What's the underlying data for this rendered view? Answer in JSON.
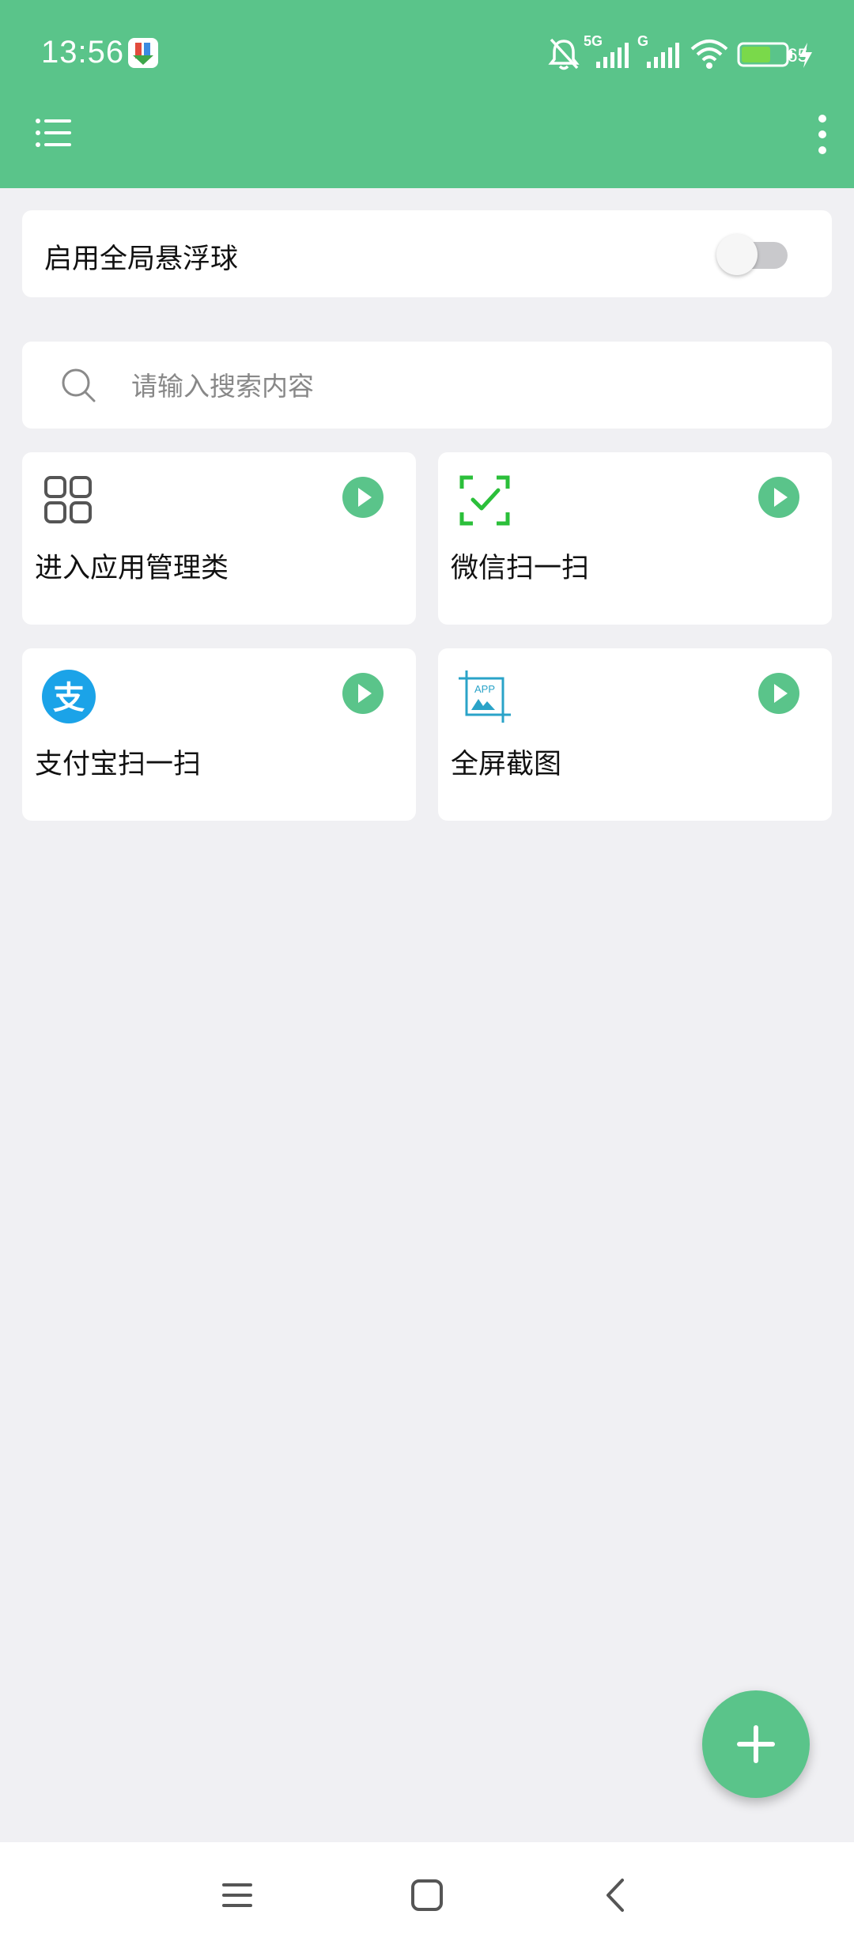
{
  "status_bar": {
    "time": "13:56",
    "battery": "65",
    "icons": [
      "app-notification-icon",
      "silent-bell-icon",
      "signal-5g-icon",
      "signal-g-icon",
      "wifi-icon",
      "battery-icon",
      "charging-icon"
    ]
  },
  "toolbar": {
    "menu_icon": "list-menu-icon",
    "more_icon": "more-vertical-icon"
  },
  "float_ball": {
    "label": "启用全局悬浮球",
    "enabled": false
  },
  "search": {
    "placeholder": "请输入搜索内容"
  },
  "cards": [
    {
      "title": "进入应用管理类",
      "icon": "app-grid-icon"
    },
    {
      "title": "微信扫一扫",
      "icon": "wechat-scan-icon"
    },
    {
      "title": "支付宝扫一扫",
      "icon": "alipay-icon"
    },
    {
      "title": "全屏截图",
      "icon": "screenshot-icon"
    }
  ],
  "fab": {
    "icon": "plus-icon"
  },
  "nav": {
    "icons": [
      "recents-icon",
      "home-icon",
      "back-icon"
    ]
  },
  "colors": {
    "primary": "#5ac48a",
    "background": "#f0f0f3"
  }
}
